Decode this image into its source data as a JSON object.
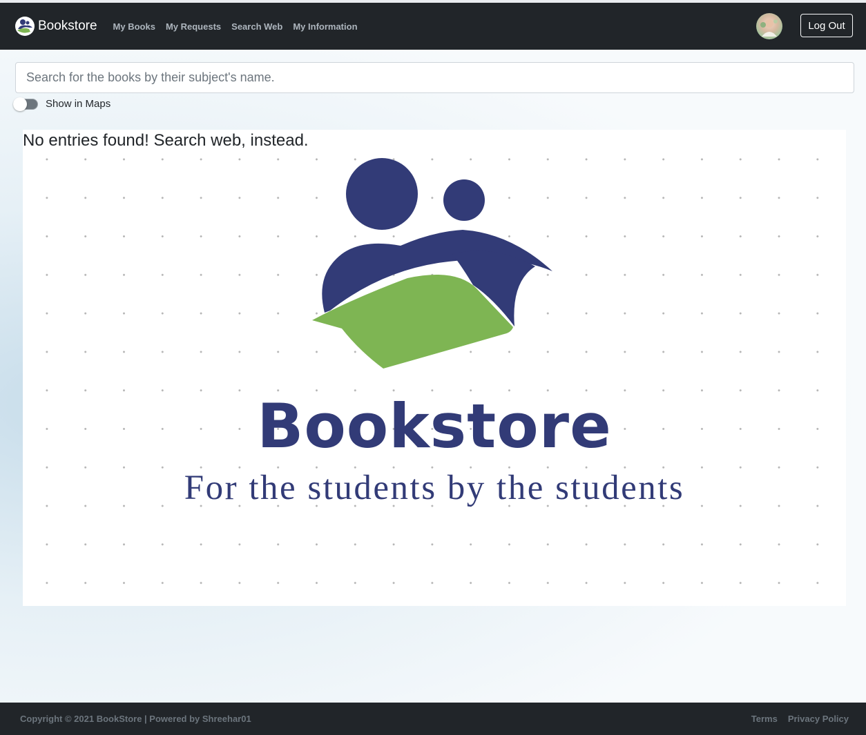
{
  "navbar": {
    "brand": "Bookstore",
    "links": [
      "My Books",
      "My Requests",
      "Search Web",
      "My Information"
    ],
    "logout_label": "Log Out",
    "bg_color": "#212529"
  },
  "search": {
    "placeholder": "Search for the books by their subject's name.",
    "value": ""
  },
  "maps_toggle": {
    "label": "Show in Maps",
    "checked": false
  },
  "results": {
    "empty_message": "No entries found! Search web, instead."
  },
  "logo": {
    "title": "Bookstore",
    "tagline": "For the students by the students",
    "primary_color": "#323b77",
    "accent_color": "#7eb553"
  },
  "footer": {
    "copyright": "Copyright © 2021 BookStore | Powered by Shreehar01",
    "links": [
      "Terms",
      "Privacy Policy"
    ]
  }
}
